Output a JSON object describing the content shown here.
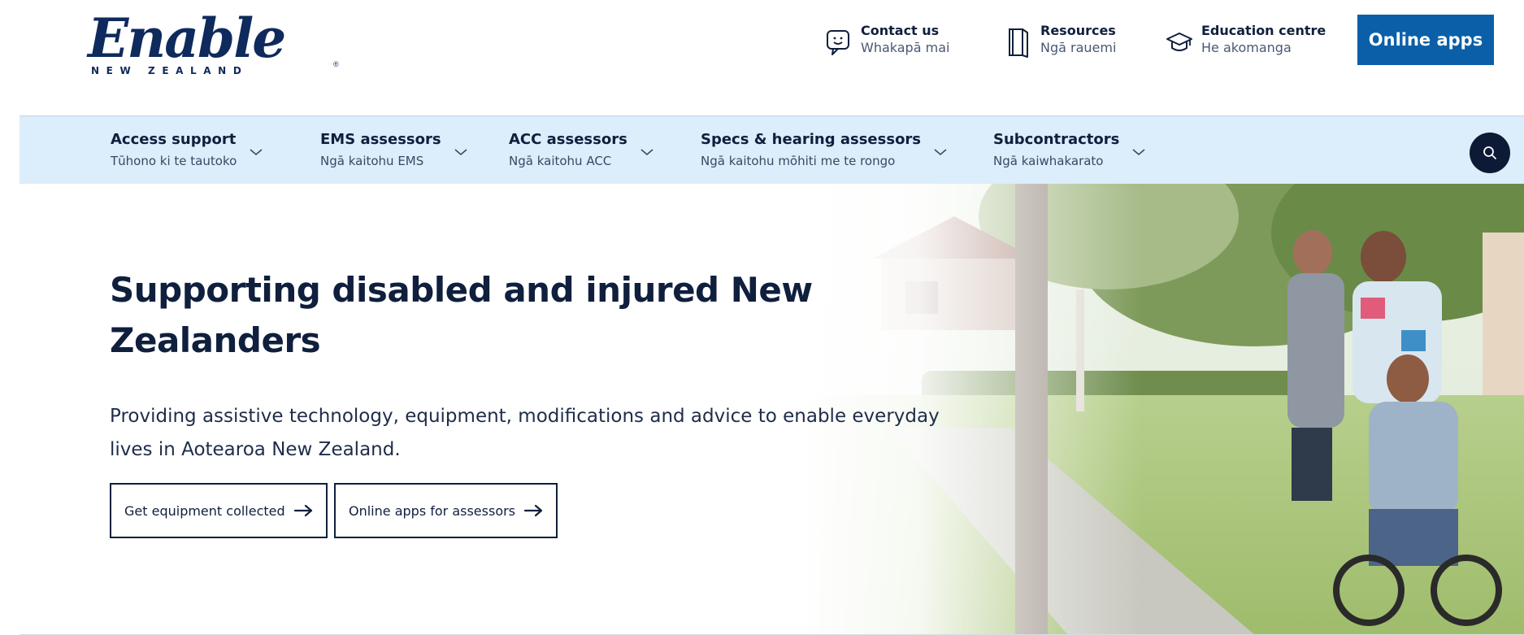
{
  "brand": {
    "logo_word": "Enable",
    "logo_sub": "NEW ZEALAND"
  },
  "utility": {
    "items": [
      {
        "title": "Contact us",
        "subtitle": "Whakapā mai",
        "icon": "chat-bubble-icon"
      },
      {
        "title": "Resources",
        "subtitle": "Ngā rauemi",
        "icon": "book-icon"
      },
      {
        "title": "Education centre",
        "subtitle": "He akomanga",
        "icon": "graduation-cap-icon"
      }
    ],
    "online_apps_label": "Online apps"
  },
  "nav": {
    "items": [
      {
        "title": "Access support",
        "subtitle": "Tūhono ki te tautoko"
      },
      {
        "title": "EMS assessors",
        "subtitle": "Ngā kaitohu EMS"
      },
      {
        "title": "ACC assessors",
        "subtitle": "Ngā kaitohu ACC"
      },
      {
        "title": "Specs & hearing assessors",
        "subtitle": "Ngā kaitohu mōhiti me te rongo"
      },
      {
        "title": "Subcontractors",
        "subtitle": "Ngā kaiwhakarato"
      }
    ],
    "search_icon": "search-icon"
  },
  "hero": {
    "title": "Supporting disabled and injured New Zealanders",
    "description": "Providing assistive technology, equipment, modifications and advice to enable everyday lives in Aotearoa New Zealand.",
    "buttons": [
      {
        "label": "Get equipment collected"
      },
      {
        "label": "Online apps for assessors"
      }
    ]
  },
  "colors": {
    "navy": "#0f1f3d",
    "brand_blue": "#0a5fa8",
    "nav_bg": "#dcedfb"
  }
}
